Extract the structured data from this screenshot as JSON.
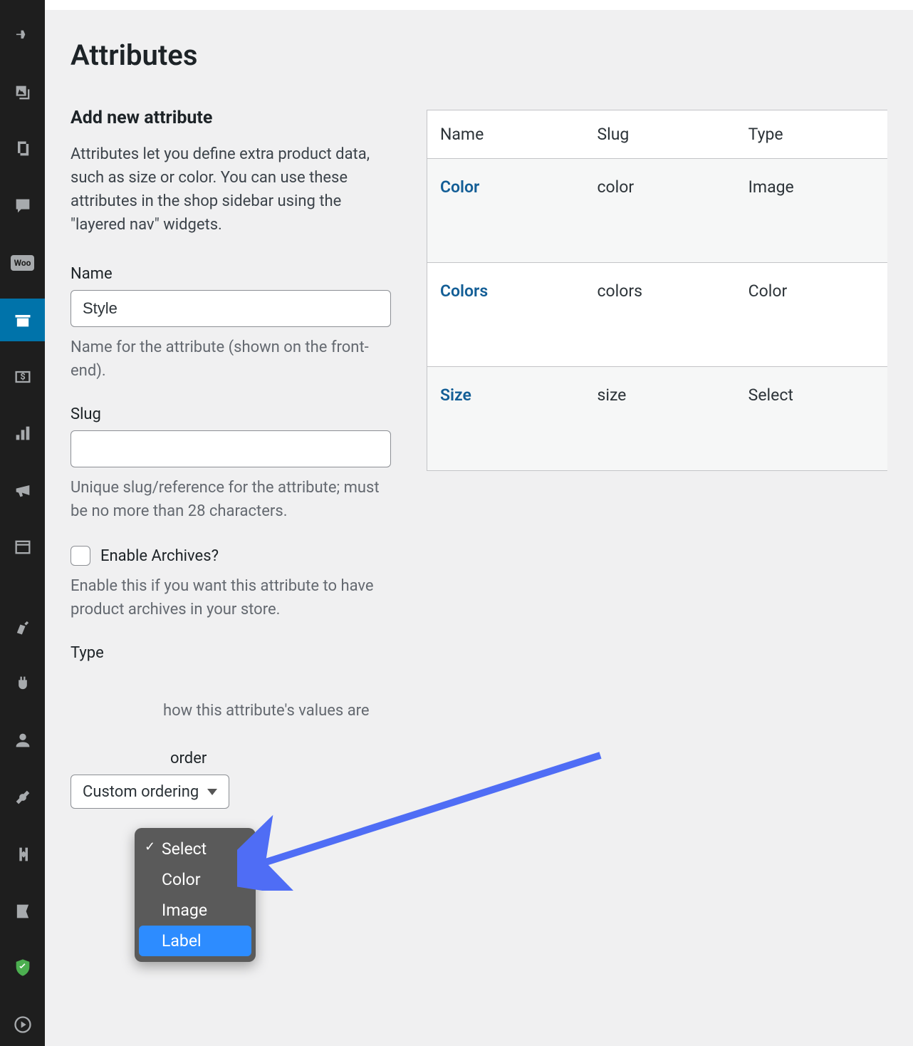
{
  "page": {
    "title": "Attributes"
  },
  "form": {
    "heading": "Add new attribute",
    "description": "Attributes let you define extra product data, such as size or color. You can use these attributes in the shop sidebar using the \"layered nav\" widgets.",
    "name_label": "Name",
    "name_value": "Style",
    "name_help": "Name for the attribute (shown on the front-end).",
    "slug_label": "Slug",
    "slug_value": "",
    "slug_help": "Unique slug/reference for the attribute; must be no more than 28 characters.",
    "archives_label": "Enable Archives?",
    "archives_help": "Enable this if you want this attribute to have product archives in your store.",
    "type_label": "Type",
    "type_help": "how this attribute's values are",
    "sort_label": "order",
    "sort_value": "Custom ordering"
  },
  "type_dropdown": {
    "options": [
      "Select",
      "Color",
      "Image",
      "Label"
    ],
    "selected": "Select",
    "highlighted": "Label"
  },
  "table": {
    "headers": {
      "name": "Name",
      "slug": "Slug",
      "type": "Type"
    },
    "rows": [
      {
        "name": "Color",
        "slug": "color",
        "type": "Image"
      },
      {
        "name": "Colors",
        "slug": "colors",
        "type": "Color"
      },
      {
        "name": "Size",
        "slug": "size",
        "type": "Select"
      }
    ]
  }
}
